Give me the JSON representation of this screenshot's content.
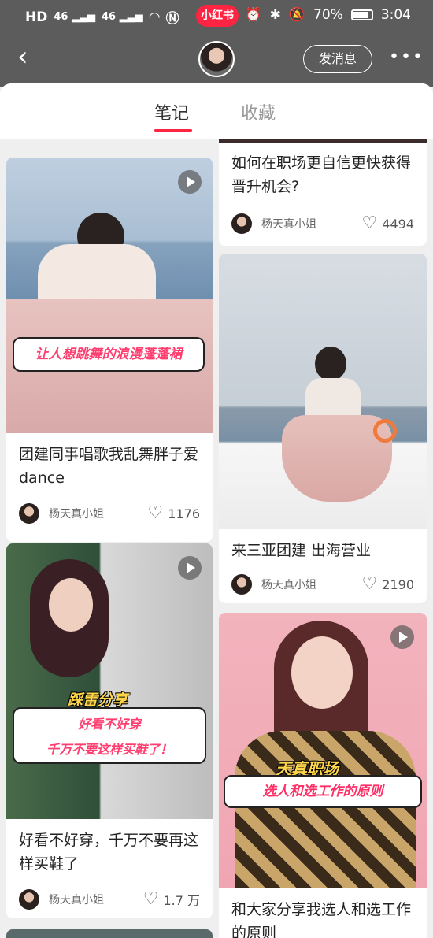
{
  "status_bar": {
    "left": "HD 46 .ıll 46 .ıll",
    "app_name": "小红书",
    "battery": "70%",
    "time": "3:04"
  },
  "header": {
    "back_label": "‹",
    "message_button": "发消息",
    "more_label": "•••"
  },
  "tabs": [
    {
      "label": "笔记",
      "active": true
    },
    {
      "label": "收藏",
      "active": false
    }
  ],
  "cards": [
    {
      "title": "团建同事唱歌我乱舞胖子爱dance",
      "overlay": "让人想跳舞的浪漫蓬蓬裙",
      "author": "杨天真小姐",
      "likes": "1176"
    },
    {
      "title": "如何在职场更自信更快获得晋升机会?",
      "author": "杨天真小姐",
      "likes": "4494"
    },
    {
      "title": "来三亚团建 出海营业",
      "author": "杨天真小姐",
      "likes": "2190"
    },
    {
      "title": "好看不好穿，千万不要再这样买鞋了",
      "overlay_top": "踩雷分享",
      "overlay_main_1": "好看不好穿",
      "overlay_main_2": "千万不要这样买鞋了！",
      "author": "杨天真小姐",
      "likes": "1.7 万"
    },
    {
      "title": "和大家分享我选人和选工作的原则",
      "overlay_top": "天真职场",
      "overlay_main": "选人和选工作的原则",
      "author": "杨天真小姐",
      "likes": ""
    }
  ]
}
